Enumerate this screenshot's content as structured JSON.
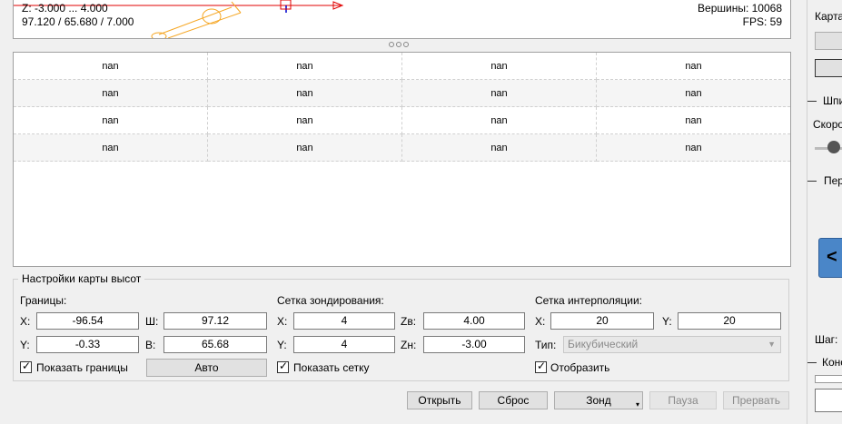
{
  "viewport": {
    "z_range": "Z: -3.000 ... 4.000",
    "dims": "97.120 / 65.680 / 7.000",
    "vertices": "Вершины: 10068",
    "fps": "FPS: 59"
  },
  "table": {
    "rows": [
      [
        "nan",
        "nan",
        "nan",
        "nan"
      ],
      [
        "nan",
        "nan",
        "nan",
        "nan"
      ],
      [
        "nan",
        "nan",
        "nan",
        "nan"
      ],
      [
        "nan",
        "nan",
        "nan",
        "nan"
      ]
    ]
  },
  "heightmap": {
    "title": "Настройки карты высот",
    "bounds": {
      "label": "Границы:",
      "x_label": "X:",
      "x_value": "-96.54",
      "w_label": "Ш:",
      "w_value": "97.12",
      "y_label": "Y:",
      "y_value": "-0.33",
      "h_label": "В:",
      "h_value": "65.68",
      "show_label": "Показать границы",
      "auto_button": "Авто"
    },
    "probe_grid": {
      "label": "Сетка зондирования:",
      "x_label": "X:",
      "x_value": "4",
      "y_label": "Y:",
      "y_value": "4",
      "zt_label": "Zв:",
      "zt_value": "4.00",
      "zb_label": "Zн:",
      "zb_value": "-3.00",
      "show_label": "Показать сетку"
    },
    "interp_grid": {
      "label": "Сетка интерполяции:",
      "x_label": "X:",
      "x_value": "20",
      "y_label": "Y:",
      "y_value": "20",
      "type_label": "Тип:",
      "type_value": "Бикубический",
      "show_label": "Отобразить"
    }
  },
  "buttons": {
    "open": "Открыть",
    "reset": "Сброс",
    "probe": "Зонд",
    "pause": "Пауза",
    "abort": "Прервать"
  },
  "right_panel": {
    "map_label": "Карта",
    "spindle_title": "Шпи",
    "speed_label": "Скоро",
    "jog_title": "Пер",
    "step_label": "Шаг:",
    "console_title": "Конс"
  },
  "colors": {
    "toolpath": "#f5a623",
    "axis_x": "#e00000",
    "axis_y": "#0000cc",
    "jog_button": "#4a86c8"
  }
}
